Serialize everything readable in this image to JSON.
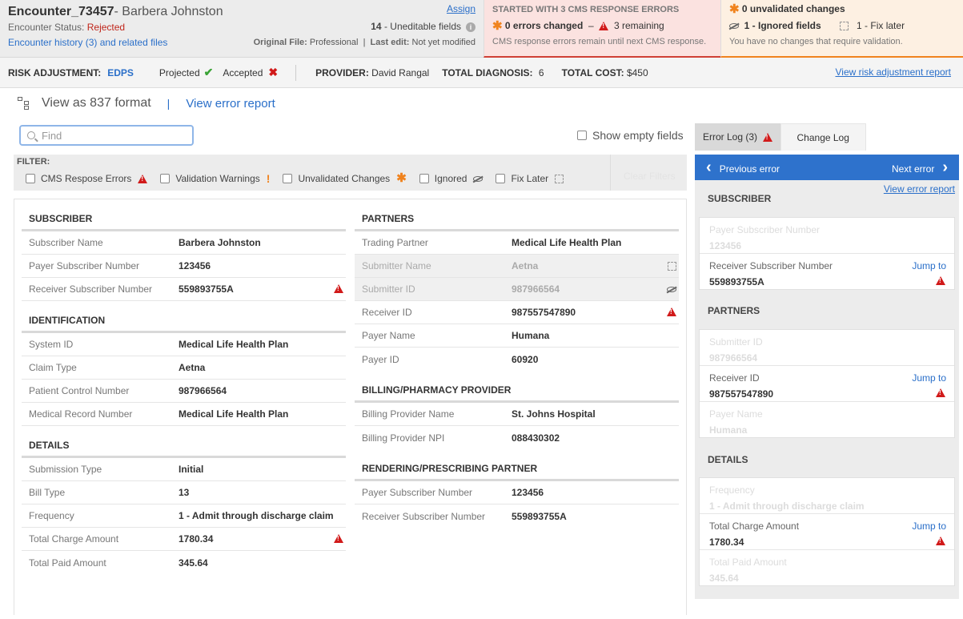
{
  "header": {
    "encounter_id": "Encounter_73457",
    "patient": "- Barbera Johnston",
    "status_label": "Encounter Status:",
    "status_value": "Rejected",
    "history_link": "Encounter history (3) and related files",
    "assign": "Assign",
    "uneditable_count": "14",
    "uneditable_label": " - Uneditable fields",
    "original_label": "Original File:",
    "original_value": "Professional",
    "last_edit_label": "Last edit:",
    "last_edit_value": "Not yet modified"
  },
  "cms": {
    "heading": "STARTED WITH 3 CMS RESPONSE ERRORS",
    "errors_changed": "0 errors changed",
    "dash": "–",
    "remaining": "3 remaining",
    "note": "CMS response errors remain until next CMS response."
  },
  "unvalidated": {
    "title": "0 unvalidated changes",
    "ignored": "1 - Ignored fields",
    "fix_later": "1 - Fix later",
    "note": "You have no changes that require validation."
  },
  "risk": {
    "label": "RISK ADJUSTMENT:",
    "edps": "EDPS",
    "projected": "Projected",
    "accepted": "Accepted",
    "provider_label": "PROVIDER:",
    "provider": "David Rangal",
    "diag_label": "TOTAL DIAGNOSIS:",
    "diag": "6",
    "cost_label": "TOTAL COST:",
    "cost": "$450",
    "report_link": "View risk adjustment report"
  },
  "view": {
    "format": "View as 837 format",
    "pipe": "|",
    "error_report": "View error report"
  },
  "search": {
    "placeholder": "Find"
  },
  "show_empty": "Show empty fields",
  "filters": {
    "label": "FILTER:",
    "cms": "CMS Respose Errors",
    "validation": "Validation Warnings",
    "unvalidated": "Unvalidated Changes",
    "ignored": "Ignored",
    "fix_later": "Fix Later",
    "clear": "Clear Filters"
  },
  "left_sections": [
    {
      "title": "SUBSCRIBER",
      "rows": [
        {
          "k": "Subscriber Name",
          "v": "Barbera Johnston"
        },
        {
          "k": "Payer Subscriber Number",
          "v": "123456"
        },
        {
          "k": "Receiver Subscriber Number",
          "v": "559893755A"
        }
      ]
    },
    {
      "title": "IDENTIFICATION",
      "rows": [
        {
          "k": "System ID",
          "v": "Medical Life Health Plan"
        },
        {
          "k": "Claim Type",
          "v": "Aetna"
        },
        {
          "k": "Patient Control Number",
          "v": "987966564"
        },
        {
          "k": "Medical Record Number",
          "v": "Medical Life Health Plan"
        }
      ]
    },
    {
      "title": "DETAILS",
      "rows": [
        {
          "k": "Submission Type",
          "v": "Initial"
        },
        {
          "k": "Bill Type",
          "v": "13"
        },
        {
          "k": "Frequency",
          "v": "1 - Admit through discharge claim"
        },
        {
          "k": "Total Charge Amount",
          "v": "1780.34"
        },
        {
          "k": "Total Paid Amount",
          "v": "345.64"
        }
      ]
    }
  ],
  "right_sections": [
    {
      "title": "PARTNERS",
      "rows": [
        {
          "k": "Trading Partner",
          "v": "Medical Life Health Plan"
        },
        {
          "k": "Submitter Name",
          "v": "Aetna"
        },
        {
          "k": "Submitter ID",
          "v": "987966564"
        },
        {
          "k": "Receiver ID",
          "v": "987557547890"
        },
        {
          "k": "Payer Name",
          "v": "Humana"
        },
        {
          "k": "Payer ID",
          "v": "60920"
        }
      ]
    },
    {
      "title": "BILLING/PHARMACY PROVIDER",
      "rows": [
        {
          "k": "Billing Provider Name",
          "v": "St. Johns Hospital"
        },
        {
          "k": "Billing Provider NPI",
          "v": "088430302"
        }
      ]
    },
    {
      "title": "RENDERING/PRESCRIBING PARTNER",
      "rows": [
        {
          "k": "Payer Subscriber Number",
          "v": "123456"
        },
        {
          "k": "Receiver Subscriber Number",
          "v": "559893755A"
        }
      ]
    }
  ],
  "panel": {
    "tab_error": "Error Log (3)",
    "tab_change": "Change Log",
    "prev": "Previous error",
    "next": "Next error",
    "error_report": "View error report",
    "jump": "Jump to",
    "sections": [
      {
        "title": "SUBSCRIBER",
        "rows": [
          {
            "k": "Payer Subscriber Number",
            "v": "123456"
          },
          {
            "k": "Receiver Subscriber Number",
            "v": "559893755A"
          }
        ]
      },
      {
        "title": "PARTNERS",
        "rows": [
          {
            "k": "Submitter ID",
            "v": "987966564"
          },
          {
            "k": "Receiver ID",
            "v": "987557547890"
          },
          {
            "k": "Payer Name",
            "v": "Humana"
          }
        ]
      },
      {
        "title": "DETAILS",
        "rows": [
          {
            "k": "Frequency",
            "v": "1 - Admit through discharge claim"
          },
          {
            "k": "Total Charge Amount",
            "v": "1780.34"
          },
          {
            "k": "Total Paid Amount",
            "v": "345.64"
          }
        ]
      }
    ]
  },
  "colors": {
    "accent": "#2e72cc",
    "error": "#d11a1a",
    "warning": "#f0831e",
    "success": "#3aa335"
  }
}
